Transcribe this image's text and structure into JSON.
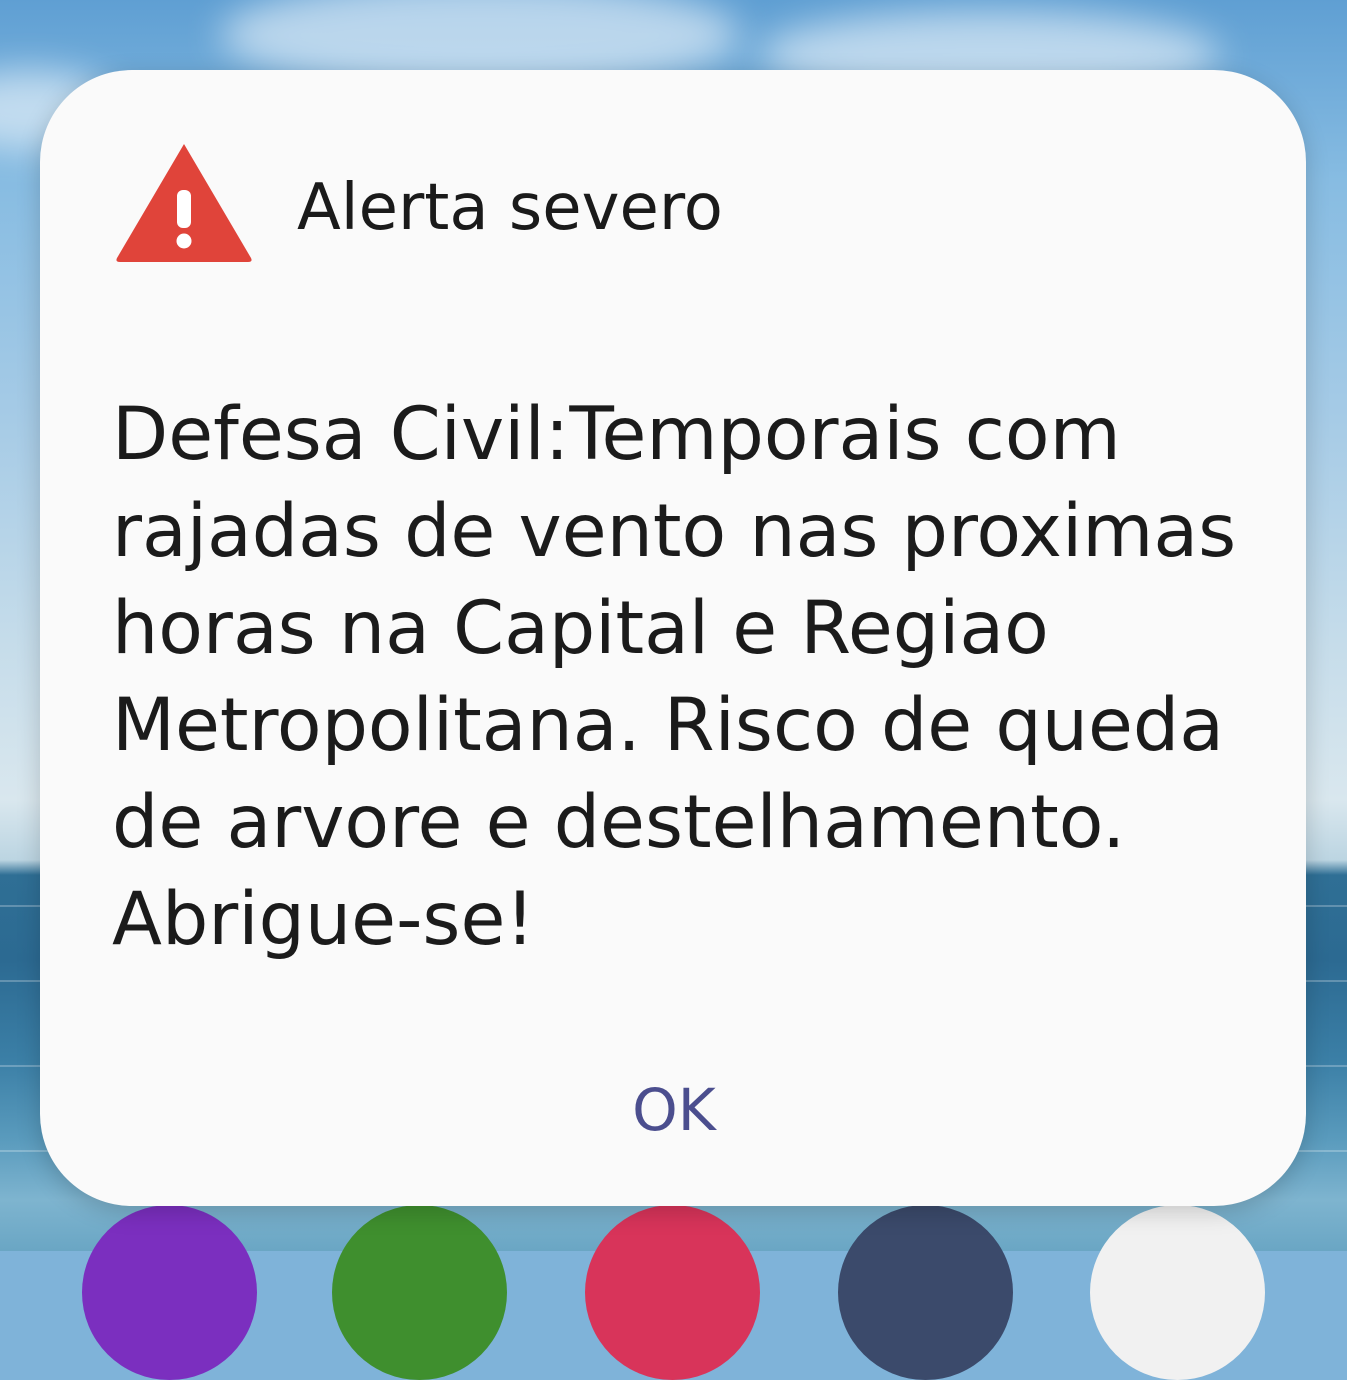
{
  "dialog": {
    "icon": "warning-triangle-icon",
    "icon_color": "#e0443a",
    "title": "Alerta severo",
    "message": "Defesa Civil:Temporais com rajadas de vento nas proximas horas na Capital e Regiao Metropolitana. Risco de queda de arvore e destelhamento. Abrigue-se!",
    "ok_label": "OK",
    "ok_color": "#4b4e8e"
  },
  "dock": {
    "icons": [
      {
        "name": "purple-app-icon",
        "color": "#7b2fbf"
      },
      {
        "name": "phone-app-icon",
        "color": "#3f8f2e"
      },
      {
        "name": "messages-app-icon",
        "color": "#d8345a"
      },
      {
        "name": "settings-app-icon",
        "color": "#3b4a6b"
      },
      {
        "name": "gallery-app-icon",
        "color": "#f1f1f1"
      }
    ]
  }
}
